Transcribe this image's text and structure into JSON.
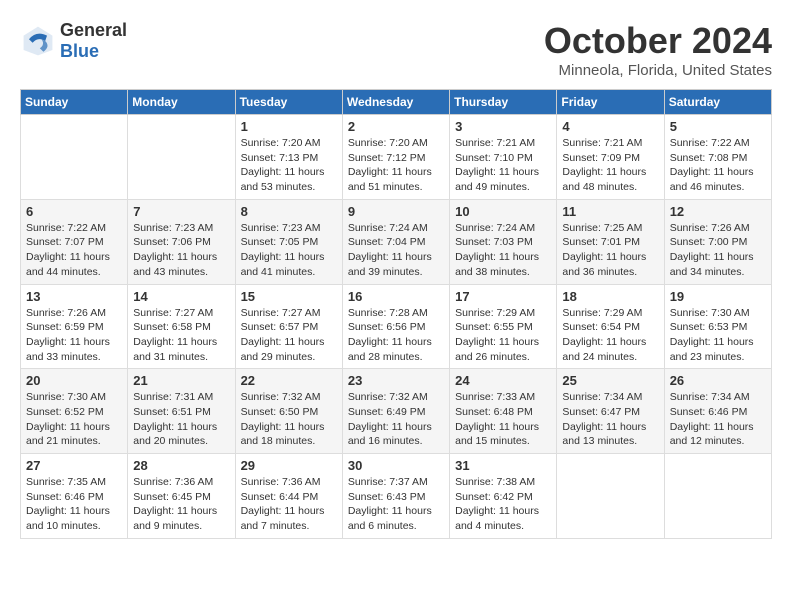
{
  "header": {
    "logo_general": "General",
    "logo_blue": "Blue",
    "month_title": "October 2024",
    "location": "Minneola, Florida, United States"
  },
  "days_of_week": [
    "Sunday",
    "Monday",
    "Tuesday",
    "Wednesday",
    "Thursday",
    "Friday",
    "Saturday"
  ],
  "weeks": [
    [
      {
        "day": "",
        "sunrise": "",
        "sunset": "",
        "daylight": ""
      },
      {
        "day": "",
        "sunrise": "",
        "sunset": "",
        "daylight": ""
      },
      {
        "day": "1",
        "sunrise": "Sunrise: 7:20 AM",
        "sunset": "Sunset: 7:13 PM",
        "daylight": "Daylight: 11 hours and 53 minutes."
      },
      {
        "day": "2",
        "sunrise": "Sunrise: 7:20 AM",
        "sunset": "Sunset: 7:12 PM",
        "daylight": "Daylight: 11 hours and 51 minutes."
      },
      {
        "day": "3",
        "sunrise": "Sunrise: 7:21 AM",
        "sunset": "Sunset: 7:10 PM",
        "daylight": "Daylight: 11 hours and 49 minutes."
      },
      {
        "day": "4",
        "sunrise": "Sunrise: 7:21 AM",
        "sunset": "Sunset: 7:09 PM",
        "daylight": "Daylight: 11 hours and 48 minutes."
      },
      {
        "day": "5",
        "sunrise": "Sunrise: 7:22 AM",
        "sunset": "Sunset: 7:08 PM",
        "daylight": "Daylight: 11 hours and 46 minutes."
      }
    ],
    [
      {
        "day": "6",
        "sunrise": "Sunrise: 7:22 AM",
        "sunset": "Sunset: 7:07 PM",
        "daylight": "Daylight: 11 hours and 44 minutes."
      },
      {
        "day": "7",
        "sunrise": "Sunrise: 7:23 AM",
        "sunset": "Sunset: 7:06 PM",
        "daylight": "Daylight: 11 hours and 43 minutes."
      },
      {
        "day": "8",
        "sunrise": "Sunrise: 7:23 AM",
        "sunset": "Sunset: 7:05 PM",
        "daylight": "Daylight: 11 hours and 41 minutes."
      },
      {
        "day": "9",
        "sunrise": "Sunrise: 7:24 AM",
        "sunset": "Sunset: 7:04 PM",
        "daylight": "Daylight: 11 hours and 39 minutes."
      },
      {
        "day": "10",
        "sunrise": "Sunrise: 7:24 AM",
        "sunset": "Sunset: 7:03 PM",
        "daylight": "Daylight: 11 hours and 38 minutes."
      },
      {
        "day": "11",
        "sunrise": "Sunrise: 7:25 AM",
        "sunset": "Sunset: 7:01 PM",
        "daylight": "Daylight: 11 hours and 36 minutes."
      },
      {
        "day": "12",
        "sunrise": "Sunrise: 7:26 AM",
        "sunset": "Sunset: 7:00 PM",
        "daylight": "Daylight: 11 hours and 34 minutes."
      }
    ],
    [
      {
        "day": "13",
        "sunrise": "Sunrise: 7:26 AM",
        "sunset": "Sunset: 6:59 PM",
        "daylight": "Daylight: 11 hours and 33 minutes."
      },
      {
        "day": "14",
        "sunrise": "Sunrise: 7:27 AM",
        "sunset": "Sunset: 6:58 PM",
        "daylight": "Daylight: 11 hours and 31 minutes."
      },
      {
        "day": "15",
        "sunrise": "Sunrise: 7:27 AM",
        "sunset": "Sunset: 6:57 PM",
        "daylight": "Daylight: 11 hours and 29 minutes."
      },
      {
        "day": "16",
        "sunrise": "Sunrise: 7:28 AM",
        "sunset": "Sunset: 6:56 PM",
        "daylight": "Daylight: 11 hours and 28 minutes."
      },
      {
        "day": "17",
        "sunrise": "Sunrise: 7:29 AM",
        "sunset": "Sunset: 6:55 PM",
        "daylight": "Daylight: 11 hours and 26 minutes."
      },
      {
        "day": "18",
        "sunrise": "Sunrise: 7:29 AM",
        "sunset": "Sunset: 6:54 PM",
        "daylight": "Daylight: 11 hours and 24 minutes."
      },
      {
        "day": "19",
        "sunrise": "Sunrise: 7:30 AM",
        "sunset": "Sunset: 6:53 PM",
        "daylight": "Daylight: 11 hours and 23 minutes."
      }
    ],
    [
      {
        "day": "20",
        "sunrise": "Sunrise: 7:30 AM",
        "sunset": "Sunset: 6:52 PM",
        "daylight": "Daylight: 11 hours and 21 minutes."
      },
      {
        "day": "21",
        "sunrise": "Sunrise: 7:31 AM",
        "sunset": "Sunset: 6:51 PM",
        "daylight": "Daylight: 11 hours and 20 minutes."
      },
      {
        "day": "22",
        "sunrise": "Sunrise: 7:32 AM",
        "sunset": "Sunset: 6:50 PM",
        "daylight": "Daylight: 11 hours and 18 minutes."
      },
      {
        "day": "23",
        "sunrise": "Sunrise: 7:32 AM",
        "sunset": "Sunset: 6:49 PM",
        "daylight": "Daylight: 11 hours and 16 minutes."
      },
      {
        "day": "24",
        "sunrise": "Sunrise: 7:33 AM",
        "sunset": "Sunset: 6:48 PM",
        "daylight": "Daylight: 11 hours and 15 minutes."
      },
      {
        "day": "25",
        "sunrise": "Sunrise: 7:34 AM",
        "sunset": "Sunset: 6:47 PM",
        "daylight": "Daylight: 11 hours and 13 minutes."
      },
      {
        "day": "26",
        "sunrise": "Sunrise: 7:34 AM",
        "sunset": "Sunset: 6:46 PM",
        "daylight": "Daylight: 11 hours and 12 minutes."
      }
    ],
    [
      {
        "day": "27",
        "sunrise": "Sunrise: 7:35 AM",
        "sunset": "Sunset: 6:46 PM",
        "daylight": "Daylight: 11 hours and 10 minutes."
      },
      {
        "day": "28",
        "sunrise": "Sunrise: 7:36 AM",
        "sunset": "Sunset: 6:45 PM",
        "daylight": "Daylight: 11 hours and 9 minutes."
      },
      {
        "day": "29",
        "sunrise": "Sunrise: 7:36 AM",
        "sunset": "Sunset: 6:44 PM",
        "daylight": "Daylight: 11 hours and 7 minutes."
      },
      {
        "day": "30",
        "sunrise": "Sunrise: 7:37 AM",
        "sunset": "Sunset: 6:43 PM",
        "daylight": "Daylight: 11 hours and 6 minutes."
      },
      {
        "day": "31",
        "sunrise": "Sunrise: 7:38 AM",
        "sunset": "Sunset: 6:42 PM",
        "daylight": "Daylight: 11 hours and 4 minutes."
      },
      {
        "day": "",
        "sunrise": "",
        "sunset": "",
        "daylight": ""
      },
      {
        "day": "",
        "sunrise": "",
        "sunset": "",
        "daylight": ""
      }
    ]
  ]
}
